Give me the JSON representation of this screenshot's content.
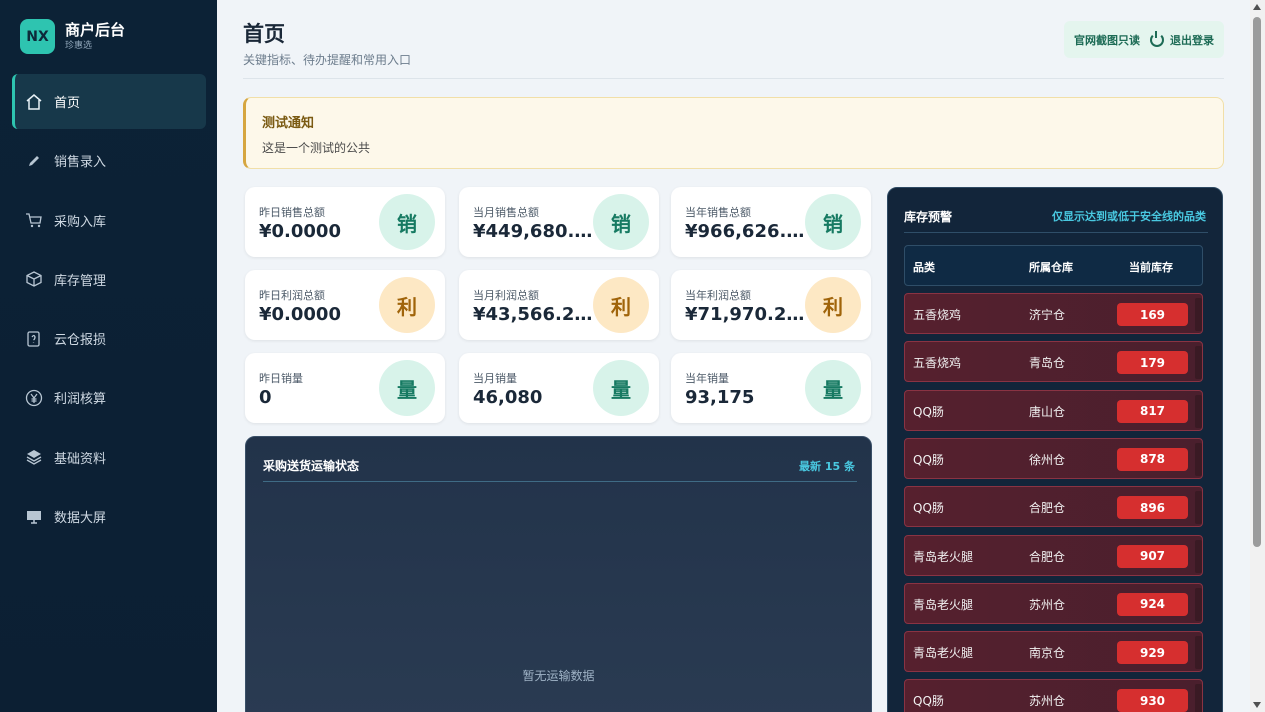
{
  "brand": {
    "logo": "NX",
    "title": "商户后台",
    "subtitle": "珍惠选"
  },
  "nav": [
    {
      "label": "首页",
      "icon": "home-icon",
      "active": true
    },
    {
      "label": "销售录入",
      "icon": "pencil-icon"
    },
    {
      "label": "采购入库",
      "icon": "cart-icon"
    },
    {
      "label": "库存管理",
      "icon": "box-icon"
    },
    {
      "label": "云仓报损",
      "icon": "report-icon"
    },
    {
      "label": "利润核算",
      "icon": "yen-icon"
    },
    {
      "label": "基础资料",
      "icon": "layers-icon"
    },
    {
      "label": "数据大屏",
      "icon": "screen-icon"
    }
  ],
  "header": {
    "title": "首页",
    "subtitle": "关键指标、待办提醒和常用入口",
    "readonly_label": "官网截图只读",
    "logout_label": "退出登录"
  },
  "notice": {
    "title": "测试通知",
    "body": "这是一个测试的公共"
  },
  "kpis": [
    {
      "label": "昨日销售总额",
      "value": "¥0.0000",
      "badge": "销",
      "kind": "sale"
    },
    {
      "label": "当月销售总额",
      "value": "¥449,680.…",
      "badge": "销",
      "kind": "sale"
    },
    {
      "label": "当年销售总额",
      "value": "¥966,626.…",
      "badge": "销",
      "kind": "sale"
    },
    {
      "label": "昨日利润总额",
      "value": "¥0.0000",
      "badge": "利",
      "kind": "profit"
    },
    {
      "label": "当月利润总额",
      "value": "¥43,566.2…",
      "badge": "利",
      "kind": "profit"
    },
    {
      "label": "当年利润总额",
      "value": "¥71,970.2…",
      "badge": "利",
      "kind": "profit"
    },
    {
      "label": "昨日销量",
      "value": "0",
      "badge": "量",
      "kind": "qty"
    },
    {
      "label": "当月销量",
      "value": "46,080",
      "badge": "量",
      "kind": "qty"
    },
    {
      "label": "当年销量",
      "value": "93,175",
      "badge": "量",
      "kind": "qty"
    }
  ],
  "shipping": {
    "title": "采购送货运输状态",
    "count": "最新 15 条",
    "empty": "暂无运输数据"
  },
  "stock": {
    "title": "库存预警",
    "hint": "仅显示达到或低于安全线的品类",
    "headers": [
      "品类",
      "所属仓库",
      "当前库存"
    ],
    "rows": [
      {
        "category": "五香烧鸡",
        "warehouse": "济宁仓",
        "qty": "169"
      },
      {
        "category": "五香烧鸡",
        "warehouse": "青岛仓",
        "qty": "179"
      },
      {
        "category": "QQ肠",
        "warehouse": "唐山仓",
        "qty": "817"
      },
      {
        "category": "QQ肠",
        "warehouse": "徐州仓",
        "qty": "878"
      },
      {
        "category": "QQ肠",
        "warehouse": "合肥仓",
        "qty": "896"
      },
      {
        "category": "青岛老火腿",
        "warehouse": "合肥仓",
        "qty": "907"
      },
      {
        "category": "青岛老火腿",
        "warehouse": "苏州仓",
        "qty": "924"
      },
      {
        "category": "青岛老火腿",
        "warehouse": "南京仓",
        "qty": "929"
      },
      {
        "category": "QQ肠",
        "warehouse": "苏州仓",
        "qty": "930"
      }
    ]
  },
  "colors": {
    "accent": "#2ec4b0",
    "alert": "#d62f2f",
    "sidebar": "#0c2236"
  }
}
